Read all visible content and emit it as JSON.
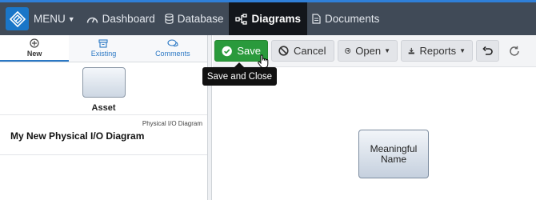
{
  "nav": {
    "menu_label": "MENU",
    "items": [
      {
        "label": "Dashboard",
        "icon": "gauge-icon"
      },
      {
        "label": "Database",
        "icon": "database-icon"
      },
      {
        "label": "Diagrams",
        "icon": "sitemap-icon",
        "active": true
      },
      {
        "label": "Documents",
        "icon": "document-icon"
      }
    ]
  },
  "left_tabs": [
    {
      "label": "New",
      "icon": "plus-circle-icon",
      "active": true
    },
    {
      "label": "Existing",
      "icon": "archive-icon"
    },
    {
      "label": "Comments",
      "icon": "comments-icon"
    }
  ],
  "palette": {
    "asset_label": "Asset"
  },
  "diagram": {
    "type": "Physical I/O Diagram",
    "name": "My New Physical I/O Diagram"
  },
  "toolbar": {
    "save_label": "Save",
    "cancel_label": "Cancel",
    "open_label": "Open",
    "reports_label": "Reports"
  },
  "tooltip": "Save and Close",
  "canvas": {
    "node_label": "Meaningful Name"
  },
  "colors": {
    "nav_bg": "#404a57",
    "accent": "#1a76c8",
    "save_green": "#2a9a3c"
  }
}
